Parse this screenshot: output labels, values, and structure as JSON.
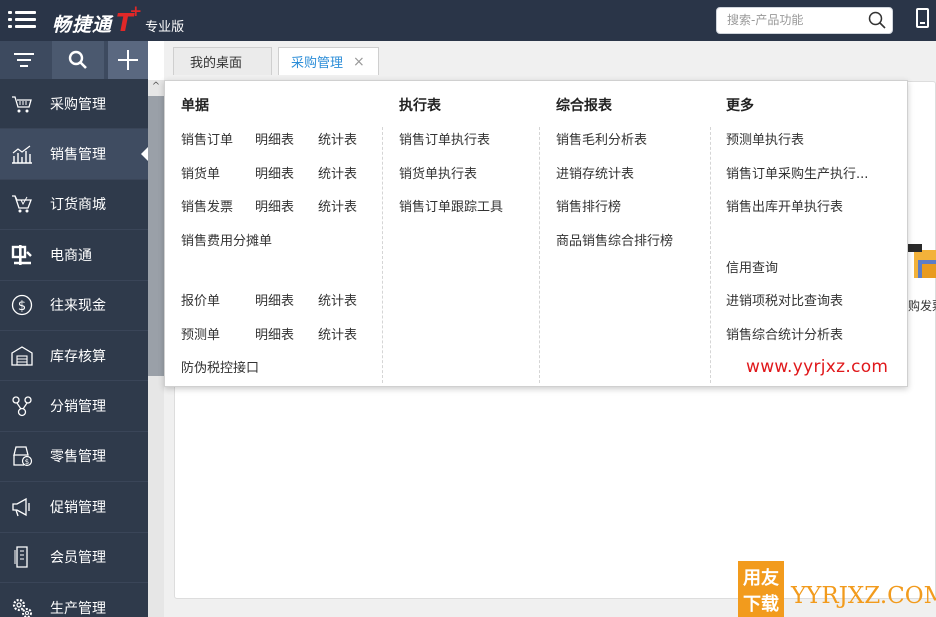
{
  "app": {
    "brand_name": "畅捷通",
    "brand_t": "T",
    "brand_plus": "+",
    "edition": "专业版",
    "search_placeholder": "搜索-产品功能"
  },
  "sidebar": {
    "items": [
      {
        "label": "采购管理",
        "icon": "shopping-basket-icon"
      },
      {
        "label": "销售管理",
        "icon": "sales-chart-icon"
      },
      {
        "label": "订货商城",
        "icon": "shopping-cart-icon"
      },
      {
        "label": "电商通",
        "icon": "ecommerce-icon"
      },
      {
        "label": "往来现金",
        "icon": "cash-icon"
      },
      {
        "label": "库存核算",
        "icon": "warehouse-icon"
      },
      {
        "label": "分销管理",
        "icon": "distribution-icon"
      },
      {
        "label": "零售管理",
        "icon": "retail-icon"
      },
      {
        "label": "促销管理",
        "icon": "megaphone-icon"
      },
      {
        "label": "会员管理",
        "icon": "member-card-icon"
      },
      {
        "label": "生产管理",
        "icon": "gears-icon"
      }
    ],
    "active_index": 1
  },
  "tabs": [
    {
      "label": "我的桌面"
    },
    {
      "label": "采购管理",
      "close": "×"
    }
  ],
  "menu": {
    "col1": {
      "head": "单据",
      "rows": [
        [
          "销售订单",
          "明细表",
          "统计表"
        ],
        [
          "销货单",
          "明细表",
          "统计表"
        ],
        [
          "销售发票",
          "明细表",
          "统计表"
        ],
        [
          "销售费用分摊单"
        ],
        [
          "报价单",
          "明细表",
          "统计表"
        ],
        [
          "预测单",
          "明细表",
          "统计表"
        ],
        [
          "防伪税控接口"
        ]
      ]
    },
    "col2": {
      "head": "执行表",
      "items": [
        "销售订单执行表",
        "销货单执行表",
        "销售订单跟踪工具"
      ]
    },
    "col3": {
      "head": "综合报表",
      "items": [
        "销售毛利分析表",
        "进销存统计表",
        "销售排行榜",
        "商品销售综合排行榜"
      ]
    },
    "col4": {
      "head": "更多",
      "items": [
        "预测单执行表",
        "销售订单采购生产执行...",
        "销售出库开单执行表",
        "信用查询",
        "进销项税对比查询表",
        "销售综合统计分析表"
      ]
    }
  },
  "desktop_partial_label": "购发票",
  "watermark": {
    "url": "www.yyrjxz.com",
    "badge_top": "用友",
    "badge_bottom": "下载",
    "brand": "YYRJXZ.COM"
  },
  "colors": {
    "topbar": "#2a3548",
    "sidebar": "#2f3a4b",
    "accent_blue": "#2d8ed8",
    "brand_red": "#e02828",
    "watermark_red": "#e0181b",
    "watermark_orange": "#f29b1d"
  }
}
